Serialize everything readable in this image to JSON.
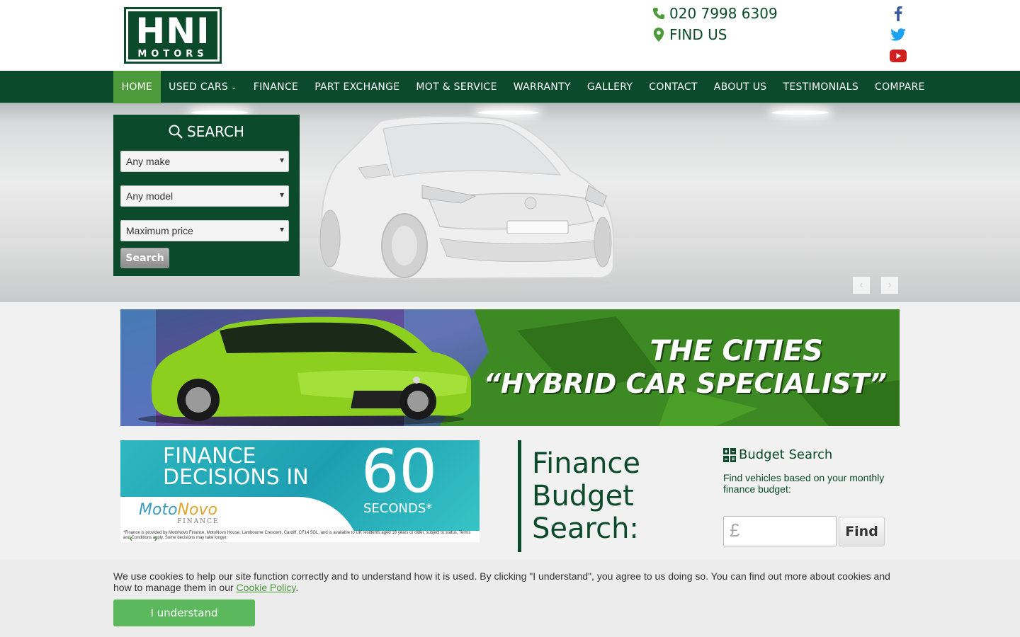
{
  "brand": {
    "logo_main": "HNI",
    "logo_sub": "MOTORS",
    "primary_color": "#0b4a2a",
    "accent_color": "#4d9a3a"
  },
  "header": {
    "phone": "020 7998 6309",
    "find_us": "FIND US"
  },
  "social": [
    {
      "icon": "facebook-icon",
      "color": "#3b5998"
    },
    {
      "icon": "twitter-icon",
      "color": "#1da1f2"
    },
    {
      "icon": "youtube-icon",
      "color": "#cd201f"
    }
  ],
  "nav": {
    "items": [
      {
        "label": "HOME",
        "active": true
      },
      {
        "label": "USED CARS",
        "has_dropdown": true
      },
      {
        "label": "FINANCE"
      },
      {
        "label": "PART EXCHANGE"
      },
      {
        "label": "MOT & SERVICE"
      },
      {
        "label": "WARRANTY"
      },
      {
        "label": "GALLERY"
      },
      {
        "label": "CONTACT"
      },
      {
        "label": "ABOUT US"
      },
      {
        "label": "TESTIMONIALS"
      },
      {
        "label": "COMPARE"
      }
    ]
  },
  "search": {
    "title": "SEARCH",
    "make": "Any make",
    "model": "Any model",
    "price": "Maximum price",
    "button": "Search"
  },
  "banner": {
    "line1": "THE CITIES",
    "line2": "“HYBRID CAR SPECIALIST”"
  },
  "finance_ad": {
    "headline_1": "FINANCE",
    "headline_2": "DECISIONS IN",
    "number": "60",
    "unit": "SECONDS*",
    "provider_a": "Moto",
    "provider_b": "Novo",
    "provider_sub": "FINANCE",
    "small_print": "*Finance is provided by MotoNovo Finance, MotoNovo House, Lambourne Crescent, Cardiff, CF14 5GL, and is available to UK residents aged 18 years or older, subject to status, Terms and Conditions apply. Some decisions may take longer."
  },
  "finance_budget": {
    "heading_1": "Finance",
    "heading_2": "Budget",
    "heading_3": "Search:"
  },
  "budget_search": {
    "title": "Budget Search",
    "description": "Find vehicles based on your monthly finance budget:",
    "currency": "£",
    "button": "Find"
  },
  "cookie": {
    "text": "We use cookies to help our site function correctly and to understand how it is used. By clicking \"I understand\", you agree to us doing so. You can find out more about cookies and how to manage them in our ",
    "link": "Cookie Policy",
    "after": ".",
    "button": "I understand"
  }
}
